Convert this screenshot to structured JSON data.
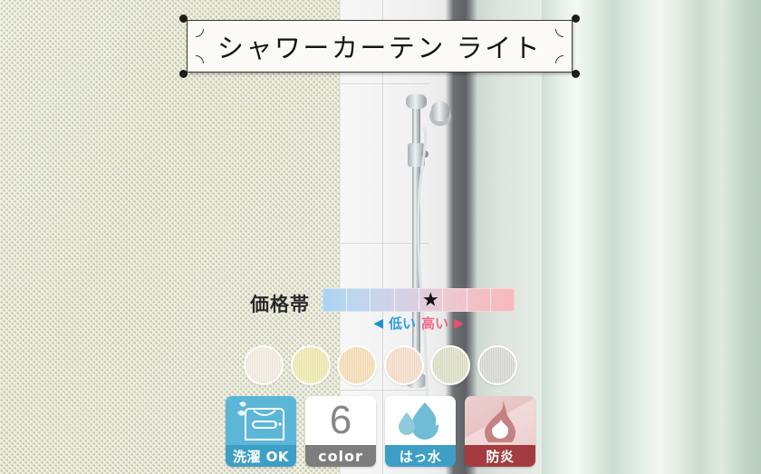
{
  "product": {
    "title": "シャワーカーテン ライト"
  },
  "price_band": {
    "label": "価格帯",
    "cells": 8,
    "star_cell_index": 5,
    "star_glyph": "★",
    "low_label": "低い",
    "high_label": "高い",
    "arrow_left": "◀",
    "arrow_right": "▶",
    "low_color": "#2f9fe0",
    "high_color": "#f06a86"
  },
  "colors": {
    "count_label": "6",
    "swatches": [
      {
        "name": "ivory",
        "hex": "#f3ece0"
      },
      {
        "name": "pale-yellow",
        "hex": "#efe9ae"
      },
      {
        "name": "apricot",
        "hex": "#f8ddb4"
      },
      {
        "name": "pale-pink",
        "hex": "#f7ddca"
      },
      {
        "name": "sage-green",
        "hex": "#dde0c6"
      },
      {
        "name": "light-grey",
        "hex": "#d8d8d2"
      }
    ]
  },
  "badges": [
    {
      "id": "wash",
      "icon": "washing-machine-icon",
      "caption": "洗濯 OK"
    },
    {
      "id": "color",
      "icon": "color-count-icon",
      "caption": "color",
      "value": "6"
    },
    {
      "id": "water",
      "icon": "water-droplet-icon",
      "caption": "はっ水"
    },
    {
      "id": "flame",
      "icon": "flame-icon",
      "caption": "防炎"
    }
  ]
}
